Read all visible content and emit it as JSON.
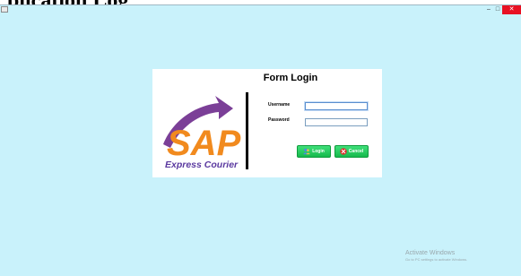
{
  "document": {
    "heading": "plication Log"
  },
  "window": {
    "controls": {
      "minimize": "–",
      "maximize": "□",
      "close": "✕"
    }
  },
  "form": {
    "title": "Form Login",
    "username_label": "Username",
    "password_label": "Password",
    "username_value": "",
    "password_value": "",
    "login_label": "Login",
    "cancel_label": "Cancel"
  },
  "logo": {
    "brand": "SAP",
    "tagline": "Express Courier",
    "colors": {
      "brand": "#f18a1e",
      "arrow": "#7b3f97",
      "tagline": "#5b3aa0"
    }
  },
  "watermark": {
    "title": "Activate Windows",
    "subtitle": "Go to PC settings to activate Windows."
  },
  "colors": {
    "window_bg": "#c9f2fb",
    "button_green": "#1fc85a",
    "close_red": "#e81123"
  }
}
